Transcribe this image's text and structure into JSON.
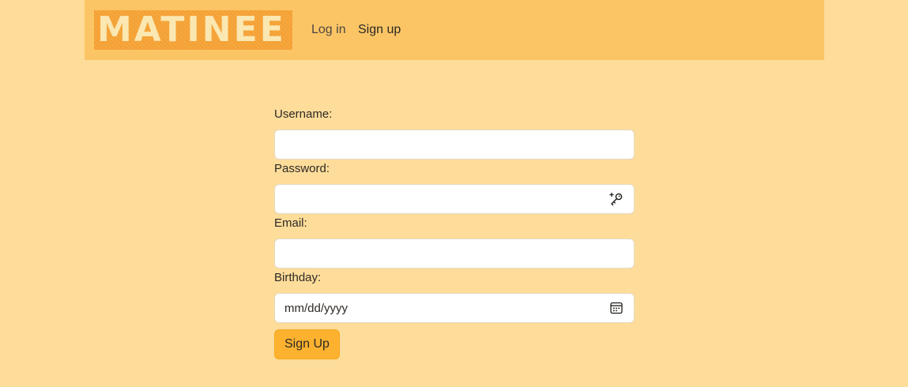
{
  "navbar": {
    "logo_text": "MATINEE",
    "links": [
      {
        "label": "Log in"
      },
      {
        "label": "Sign up"
      }
    ]
  },
  "form": {
    "username": {
      "label": "Username:",
      "value": "",
      "placeholder": ""
    },
    "password": {
      "label": "Password:",
      "value": "",
      "placeholder": "",
      "icon": "password-key-icon"
    },
    "email": {
      "label": "Email:",
      "value": "",
      "placeholder": ""
    },
    "birthday": {
      "label": "Birthday:",
      "value": "",
      "placeholder": "mm/dd/yyyy",
      "icon": "calendar-icon"
    },
    "submit_label": "Sign Up"
  },
  "colors": {
    "background": "#fedc9a",
    "navbar": "#fbc566",
    "logo_bg": "#f6a83e",
    "button": "#fdb22f"
  }
}
